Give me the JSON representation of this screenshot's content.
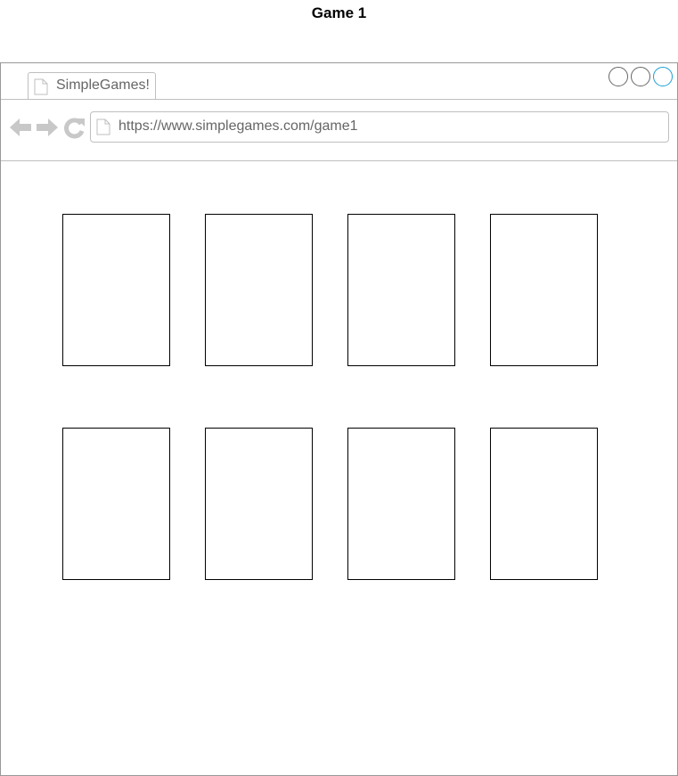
{
  "page": {
    "title": "Game 1"
  },
  "browser": {
    "tab": {
      "label": "SimpleGames!",
      "icon": "page-icon"
    },
    "window_controls": [
      {
        "name": "minimize-button",
        "icon": "circle"
      },
      {
        "name": "maximize-button",
        "icon": "circle"
      },
      {
        "name": "close-button",
        "icon": "circle",
        "color": "#1a9fd6"
      }
    ],
    "nav": {
      "back_icon": "arrow-left-icon",
      "forward_icon": "arrow-right-icon",
      "reload_icon": "reload-icon"
    },
    "address_bar": {
      "url": "https://www.simplegames.com/game1",
      "icon": "page-icon"
    }
  },
  "game": {
    "rows": 2,
    "columns": 4,
    "cards": [
      {
        "face": "down"
      },
      {
        "face": "down"
      },
      {
        "face": "down"
      },
      {
        "face": "down"
      },
      {
        "face": "down"
      },
      {
        "face": "down"
      },
      {
        "face": "down"
      },
      {
        "face": "down"
      }
    ]
  },
  "colors": {
    "accent": "#1a9fd6",
    "chrome_border": "#bfbfbf",
    "chrome_text": "#666666",
    "nav_icon": "#c8c8c8"
  }
}
